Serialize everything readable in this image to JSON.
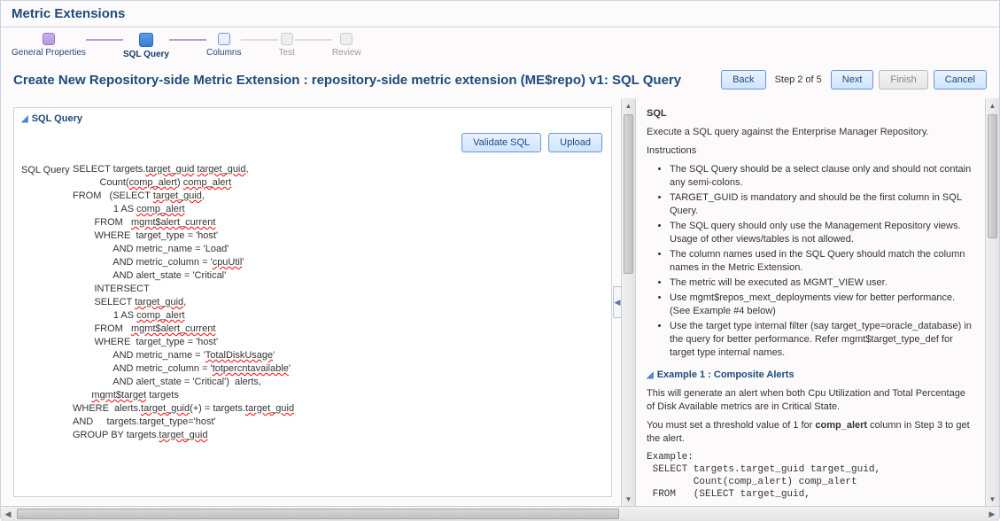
{
  "page_title": "Metric Extensions",
  "train": [
    {
      "label": "General Properties",
      "state": "done"
    },
    {
      "label": "SQL Query",
      "state": "current"
    },
    {
      "label": "Columns",
      "state": "next"
    },
    {
      "label": "Test",
      "state": "future"
    },
    {
      "label": "Review",
      "state": "future"
    }
  ],
  "subheader": "Create New Repository-side Metric Extension : repository-side metric extension (ME$repo) v1: SQL Query",
  "step_text": "Step 2 of 5",
  "buttons": {
    "back": "Back",
    "next": "Next",
    "finish": "Finish",
    "cancel": "Cancel",
    "validate": "Validate SQL",
    "upload": "Upload"
  },
  "panel_title": "SQL Query",
  "field_label": "SQL Query",
  "sql_lines": [
    [
      "SELECT targets.",
      [
        "target_guid",
        true
      ],
      " ",
      [
        "target_guid",
        true
      ],
      ","
    ],
    [
      "          Count(",
      [
        "comp_alert",
        true
      ],
      ") ",
      [
        "comp_alert",
        true
      ]
    ],
    [
      "FROM   (SELECT ",
      [
        "target_guid",
        true
      ],
      ","
    ],
    [
      "               1 AS ",
      [
        "comp_alert",
        true
      ]
    ],
    [
      "        FROM   ",
      [
        "mgmt$alert_current",
        true
      ]
    ],
    [
      "        WHERE  target_type = 'host'"
    ],
    [
      "               AND metric_name = 'Load'"
    ],
    [
      "               AND metric_column = '",
      [
        "cpuUtil",
        true
      ],
      "'"
    ],
    [
      "               AND alert_state = 'Critical'"
    ],
    [
      "        INTERSECT"
    ],
    [
      "        SELECT ",
      [
        "target_guid",
        true
      ],
      ","
    ],
    [
      "               1 AS ",
      [
        "comp_alert",
        true
      ]
    ],
    [
      "        FROM   ",
      [
        "mgmt$alert_current",
        true
      ]
    ],
    [
      "        WHERE  target_type = 'host'"
    ],
    [
      "               AND metric_name = '",
      [
        "TotalDiskUsage",
        true
      ],
      "'"
    ],
    [
      "               AND metric_column = '",
      [
        "totpercntavailable",
        true
      ],
      "'"
    ],
    [
      "               AND alert_state = 'Critical')  alerts,"
    ],
    [
      "       ",
      [
        "mgmt$target",
        true
      ],
      " targets"
    ],
    [
      "WHERE  alerts.",
      [
        "target_guid",
        true
      ],
      "(+) = targets.",
      [
        "target_guid",
        true
      ]
    ],
    [
      "AND     targets.target_type='host'"
    ],
    [
      "GROUP BY targets.",
      [
        "target_guid",
        true
      ]
    ]
  ],
  "help": {
    "title": "SQL",
    "intro": "Execute a SQL query against the Enterprise Manager Repository.",
    "instructions_label": "Instructions",
    "bullets": [
      "The SQL Query should be a select clause only and should not contain any semi-colons.",
      "TARGET_GUID is mandatory and should be the first column in SQL Query.",
      "The SQL query should only use the Management Repository views. Usage of other views/tables is not allowed.",
      "The column names used in the SQL Query should match the column names in the Metric Extension.",
      "The metric will be executed as MGMT_VIEW user.",
      "Use mgmt$repos_mext_deployments view for better performance. (See Example #4 below)",
      "Use the target type internal filter (say target_type=oracle_database) in the query for better performance. Refer mgmt$target_type_def for target type internal names."
    ],
    "example_title": "Example 1 : Composite Alerts",
    "example_p1": "This will generate an alert when both Cpu Utilization and Total Percentage of Disk Available metrics are in Critical State.",
    "example_p2_a": "You must set a threshold value of 1 for ",
    "example_p2_bold": "comp_alert",
    "example_p2_b": " column in Step 3 to get the alert.",
    "example_code": "Example:\n SELECT targets.target_guid target_guid,\n        Count(comp_alert) comp_alert\n FROM   (SELECT target_guid,"
  }
}
